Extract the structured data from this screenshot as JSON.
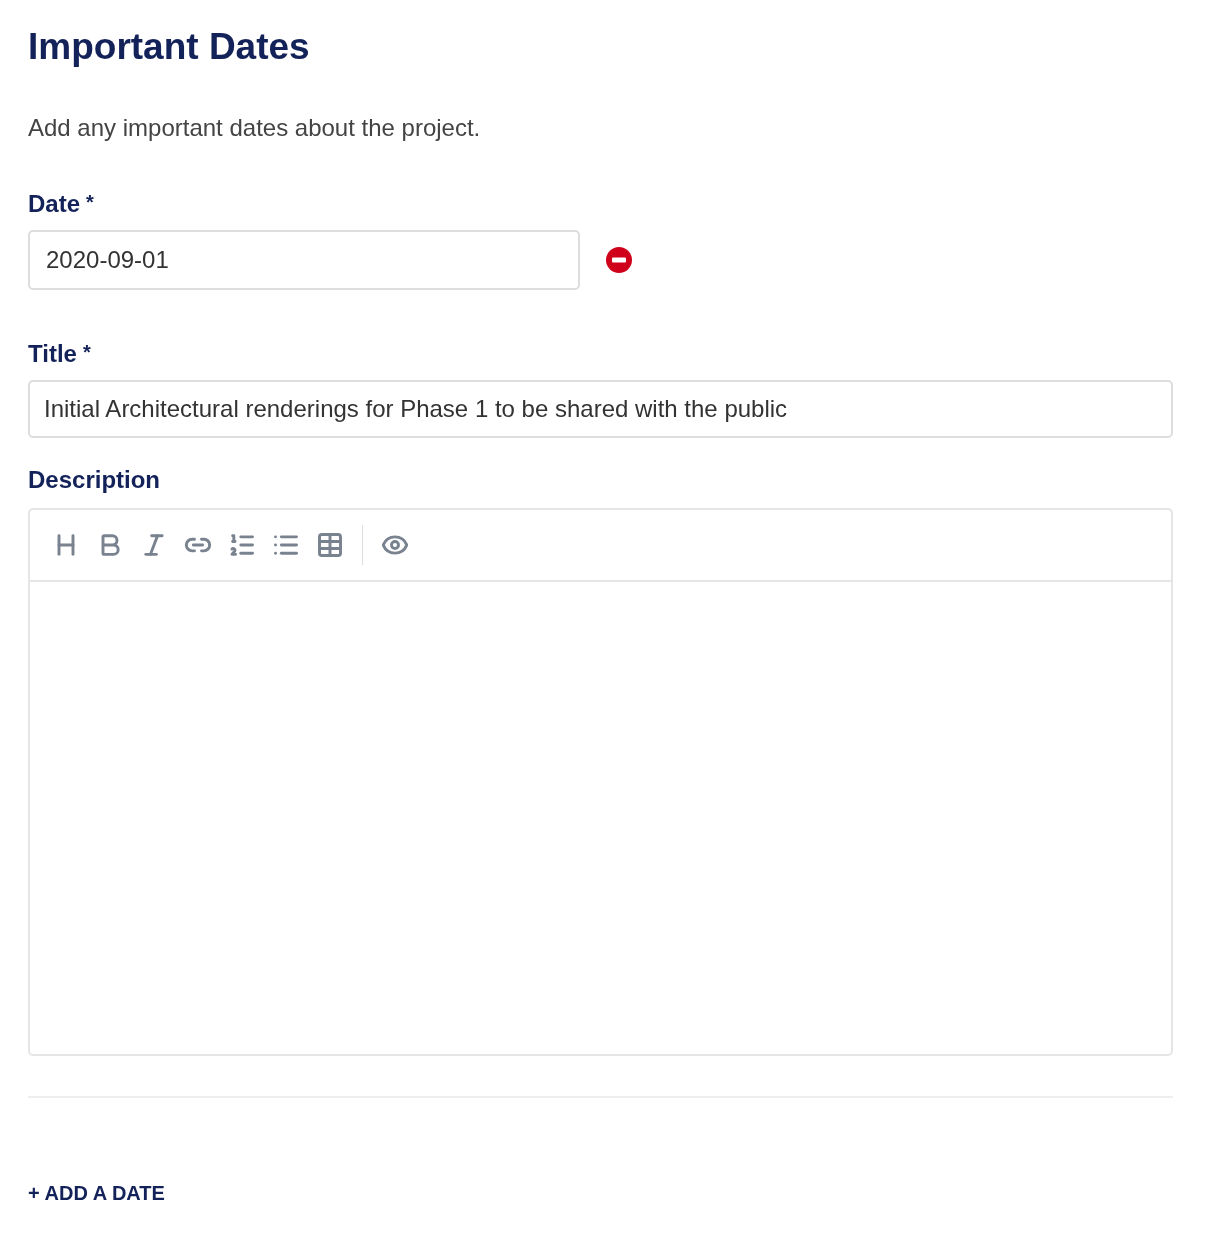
{
  "heading": "Important Dates",
  "intro": "Add any important dates about the project.",
  "date_field": {
    "label": "Date",
    "required_mark": "*",
    "value": "2020-09-01"
  },
  "title_field": {
    "label": "Title",
    "required_mark": "*",
    "value": "Initial Architectural renderings for Phase 1 to be shared with the public"
  },
  "description_field": {
    "label": "Description"
  },
  "add_button": "+ ADD A DATE"
}
